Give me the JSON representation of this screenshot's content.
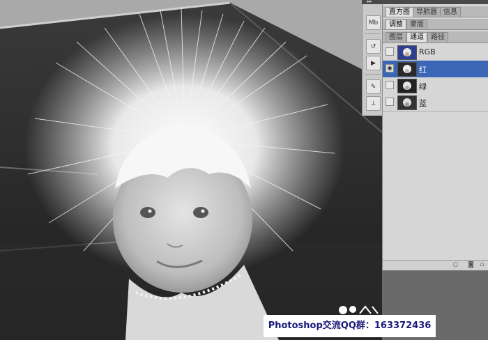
{
  "panel": {
    "top_tabs": [
      "直方图",
      "导航器",
      "信息"
    ],
    "mid_tabs": [
      "调整",
      "蒙版"
    ],
    "channel_tabs": [
      "通道",
      "路径"
    ],
    "layers_tab_partial": "图层",
    "active_tab": "通道"
  },
  "channels": [
    {
      "label": "RGB",
      "visible": false,
      "selected": false
    },
    {
      "label": "红",
      "visible": true,
      "selected": true
    },
    {
      "label": "绿",
      "visible": false,
      "selected": false
    },
    {
      "label": "蓝",
      "visible": false,
      "selected": false
    }
  ],
  "icon_strip": [
    "mini-bridge-icon",
    "history-icon",
    "actions-icon",
    "brush-presets-icon",
    "clone-source-icon"
  ],
  "footer_icons": [
    "load-selection-icon",
    "save-selection-icon"
  ],
  "watermark": {
    "text": "Photoshop交流QQ群：163372436"
  },
  "colors": {
    "selection": "#3a66b5",
    "panel_bg": "#d6d6d6",
    "watermark_text": "#1a1a7a"
  }
}
